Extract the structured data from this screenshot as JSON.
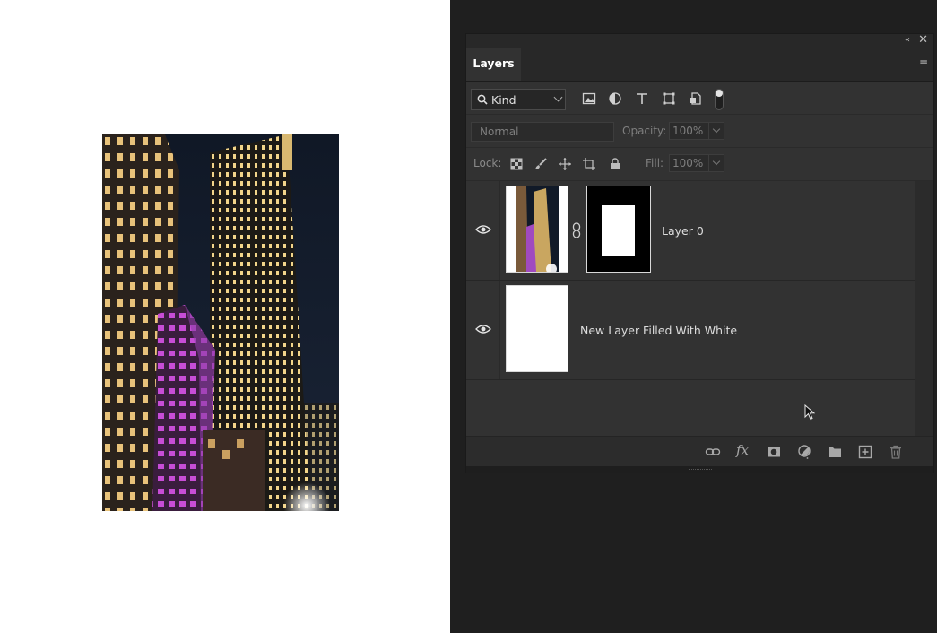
{
  "panel": {
    "tab_label": "Layers",
    "collapse_glyph": "«",
    "close_glyph": "✕",
    "menu_glyph": "≡"
  },
  "filter": {
    "kind_label": "Kind",
    "icons": [
      "image-filter-icon",
      "adjustment-filter-icon",
      "type-filter-icon",
      "shape-filter-icon",
      "smart-object-filter-icon"
    ]
  },
  "blend": {
    "mode": "Normal",
    "opacity_label": "Opacity:",
    "opacity_value": "100%"
  },
  "lock": {
    "label": "Lock:",
    "fill_label": "Fill:",
    "fill_value": "100%"
  },
  "layers": [
    {
      "name": "Layer 0",
      "visible": true,
      "has_mask": true
    },
    {
      "name": "New Layer Filled With White",
      "visible": true,
      "has_mask": false
    }
  ],
  "footer": {
    "fx_label": "fx"
  },
  "colors": {
    "panel_bg": "#323232",
    "workspace_bg": "#1f1f1f",
    "canvas_bg": "#ffffff"
  }
}
